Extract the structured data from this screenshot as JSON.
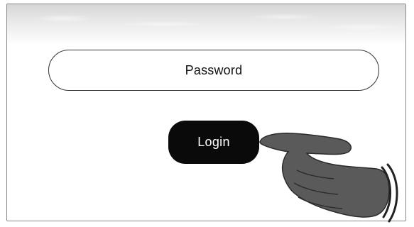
{
  "login_form": {
    "password_placeholder": "Password",
    "login_label": "Login"
  },
  "colors": {
    "button_background": "#0a0a0a",
    "button_text": "#ffffff",
    "field_border": "#333333",
    "hand_fill": "#5a5a5a"
  },
  "icons": {
    "pointer": "pointing-hand-icon"
  }
}
